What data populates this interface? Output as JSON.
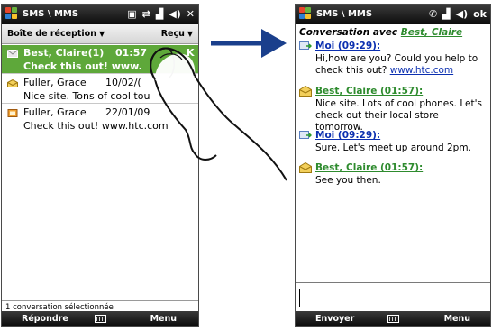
{
  "left_screen": {
    "title": "SMS \\ MMS",
    "header_left": "Boîte de réception",
    "header_right": "Reçu",
    "messages": [
      {
        "sender": "Best, Claire(1)",
        "time": "01:57",
        "time_tail": "K",
        "preview": "Check this out! www.",
        "selected": true
      },
      {
        "sender": "Fuller, Grace",
        "date": "10/02/(",
        "preview": "Nice site. Tons of cool tou"
      },
      {
        "sender": "Fuller, Grace",
        "date": "22/01/09",
        "preview": "Check this out! www.htc.com"
      }
    ],
    "status_line": "1 conversation sélectionnée",
    "softkey_left": "Répondre",
    "softkey_right": "Menu"
  },
  "right_screen": {
    "title": "SMS \\ MMS",
    "ok_label": "ok",
    "conversation_prefix": "Conversation avec",
    "conversation_contact": "Best, Claire",
    "thread": [
      {
        "who": "me",
        "head": "Moi (09:29):",
        "text": "Hi,how are you? Could you help to check this out?",
        "link": "www.htc.com"
      },
      {
        "who": "them",
        "head": "Best, Claire (01:57):",
        "text": "Nice site. Lots of cool phones. Let's check out their local store tomorrow."
      },
      {
        "who": "me",
        "head": "Moi (09:29):",
        "text": "Sure. Let's meet up around 2pm."
      },
      {
        "who": "them",
        "head": "Best, Claire (01:57):",
        "text": "See you then."
      }
    ],
    "softkey_left": "Envoyer",
    "softkey_right": "Menu"
  },
  "colors": {
    "selection_green": "#5ea83a",
    "contact_green": "#2e8b2e",
    "link_blue": "#0b2fb0",
    "arrow_blue": "#1a3f8c"
  },
  "icons": [
    "windows-logo-icon",
    "keyboard-icon",
    "envelope-icon",
    "signal-icon",
    "volume-icon",
    "close-icon",
    "arrow-right-icon",
    "hand-gesture-icon"
  ]
}
